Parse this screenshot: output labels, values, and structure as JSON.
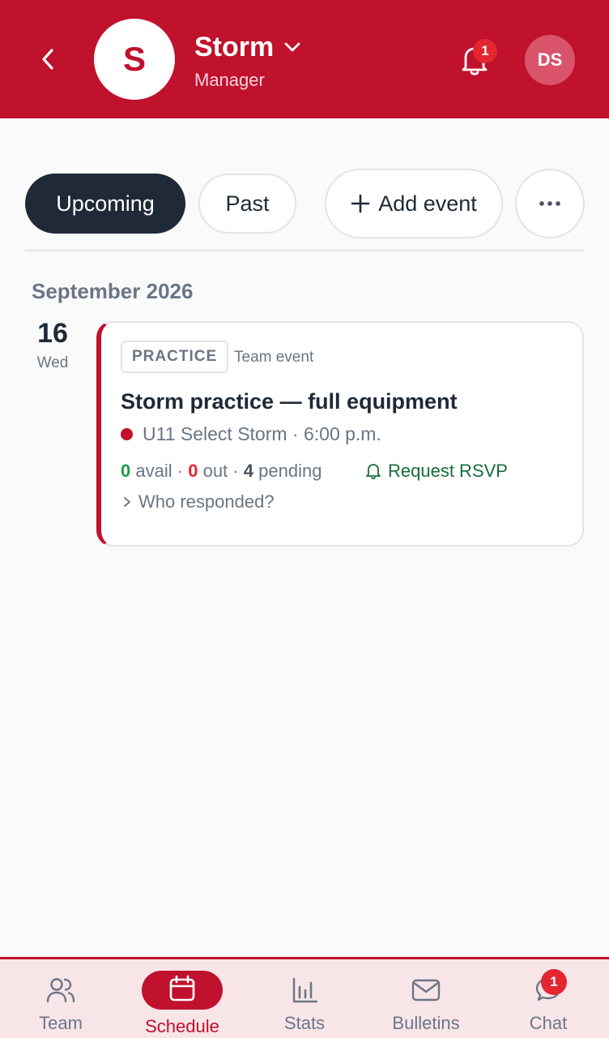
{
  "header": {
    "team_initial": "S",
    "team_name": "Storm",
    "role": "Manager",
    "notification_count": "1",
    "user_initials": "DS"
  },
  "filters": {
    "upcoming_label": "Upcoming",
    "past_label": "Past",
    "add_event_label": "Add event"
  },
  "schedule": {
    "month": "September 2026",
    "events": [
      {
        "day_number": "16",
        "day_name": "Wed",
        "tag": "PRACTICE",
        "type": "Team event",
        "title": "Storm practice — full equipment",
        "team_time": "U11 Select Storm · 6:00 p.m.",
        "avail_count": "0",
        "avail_label": "avail",
        "sep1": "·",
        "out_count": "0",
        "out_label": "out",
        "sep2": "·",
        "pending_count": "4",
        "pending_label": "pending",
        "request_rsvp_label": "Request RSVP",
        "who_responded_label": "Who responded?"
      }
    ]
  },
  "bottom_nav": {
    "items": [
      {
        "label": "Team",
        "icon": "users-icon"
      },
      {
        "label": "Schedule",
        "icon": "calendar-icon"
      },
      {
        "label": "Stats",
        "icon": "bar-chart-icon"
      },
      {
        "label": "Bulletins",
        "icon": "mail-icon"
      },
      {
        "label": "Chat",
        "icon": "chat-icon"
      }
    ],
    "active": "Schedule",
    "chat_badge": "1"
  },
  "colors": {
    "brand": "#c0112d",
    "dark": "#1f2937",
    "muted": "#6b7586",
    "green": "#1f9d45",
    "red": "#e3262f"
  }
}
